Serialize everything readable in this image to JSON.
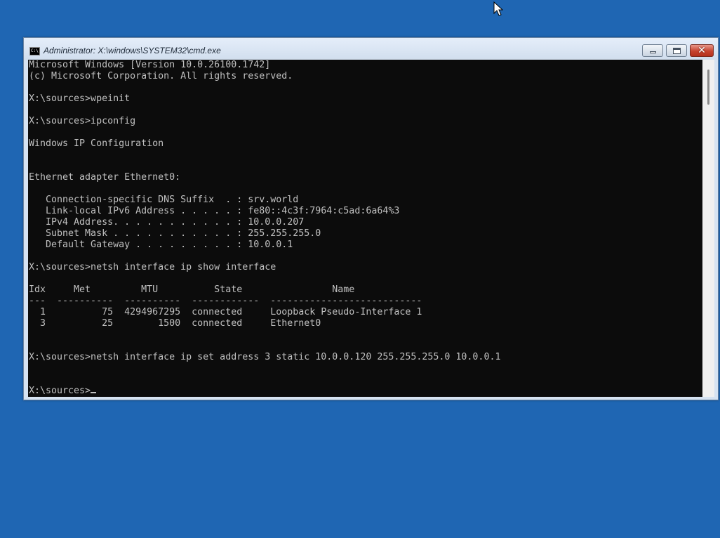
{
  "window": {
    "title": "Administrator: X:\\windows\\SYSTEM32\\cmd.exe",
    "icon": "cmd-icon",
    "controls": {
      "minimize": "minimize-icon",
      "maximize": "maximize-icon",
      "close_glyph": "✕"
    }
  },
  "console": {
    "lines": [
      "Microsoft Windows [Version 10.0.26100.1742]",
      "(c) Microsoft Corporation. All rights reserved.",
      "",
      "X:\\sources>wpeinit",
      "",
      "X:\\sources>ipconfig",
      "",
      "Windows IP Configuration",
      "",
      "",
      "Ethernet adapter Ethernet0:",
      "",
      "   Connection-specific DNS Suffix  . : srv.world",
      "   Link-local IPv6 Address . . . . . : fe80::4c3f:7964:c5ad:6a64%3",
      "   IPv4 Address. . . . . . . . . . . : 10.0.0.207",
      "   Subnet Mask . . . . . . . . . . . : 255.255.255.0",
      "   Default Gateway . . . . . . . . . : 10.0.0.1",
      "",
      "X:\\sources>netsh interface ip show interface",
      "",
      "Idx     Met         MTU          State                Name",
      "---  ----------  ----------  ------------  ---------------------------",
      "  1          75  4294967295  connected     Loopback Pseudo-Interface 1",
      "  3          25        1500  connected     Ethernet0",
      "",
      "",
      "X:\\sources>netsh interface ip set address 3 static 10.0.0.120 255.255.255.0 10.0.0.1",
      "",
      ""
    ],
    "prompt": "X:\\sources>"
  },
  "colors": {
    "desktop": "#1f66b3",
    "console_bg": "#0c0c0c",
    "console_fg": "#c0c0c0",
    "close_button": "#c6432f"
  }
}
